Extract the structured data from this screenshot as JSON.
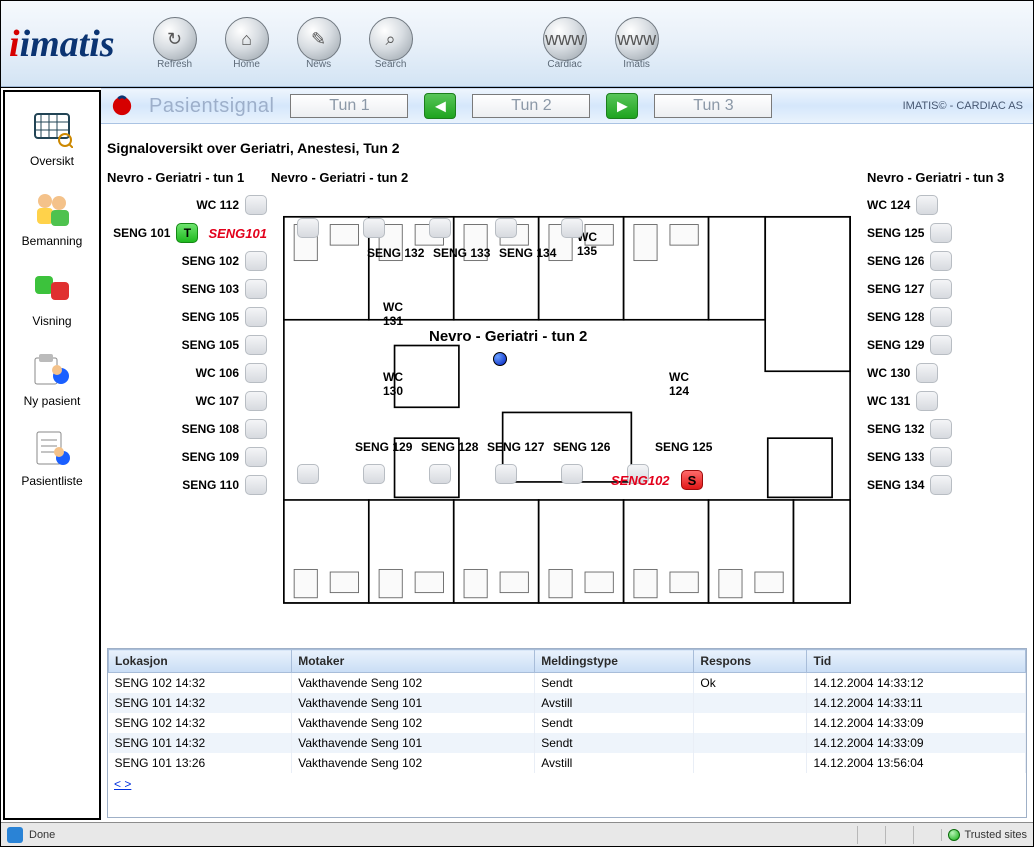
{
  "logo_text": "imatis",
  "top_buttons": [
    {
      "label": "Refresh",
      "icon": "↻"
    },
    {
      "label": "Home",
      "icon": "⌂"
    },
    {
      "label": "News",
      "icon": "✎"
    },
    {
      "label": "Search",
      "icon": "⌕"
    },
    {
      "label": "Cardiac",
      "icon": "www"
    },
    {
      "label": "Imatis",
      "icon": "www"
    }
  ],
  "sidebar": [
    {
      "label": "Oversikt",
      "name": "side-oversikt"
    },
    {
      "label": "Bemanning",
      "name": "side-bemanning"
    },
    {
      "label": "Visning",
      "name": "side-visning"
    },
    {
      "label": "Ny pasient",
      "name": "side-ny-pasient"
    },
    {
      "label": "Pasientliste",
      "name": "side-pasientliste"
    }
  ],
  "psbar": {
    "title": "Pasientsignal",
    "tuns": [
      "Tun 1",
      "Tun 2",
      "Tun 3"
    ],
    "right": "IMATIS© - CARDIAC AS"
  },
  "heading": "Signaloversikt over Geriatri, Anestesi, Tun 2",
  "columns": {
    "left": {
      "title": "Nevro - Geriatri - tun 1",
      "rooms": [
        {
          "label": "WC 112",
          "chip": "grey"
        },
        {
          "label": "SENG 101",
          "chip": "green",
          "chiptext": "T",
          "highlight": "SENG101"
        },
        {
          "label": "SENG 102",
          "chip": "grey"
        },
        {
          "label": "SENG 103",
          "chip": "grey"
        },
        {
          "label": "SENG 105",
          "chip": "grey"
        },
        {
          "label": "SENG 105",
          "chip": "grey"
        },
        {
          "label": "WC 106",
          "chip": "grey"
        },
        {
          "label": "WC 107",
          "chip": "grey"
        },
        {
          "label": "SENG 108",
          "chip": "grey"
        },
        {
          "label": "SENG 109",
          "chip": "grey"
        },
        {
          "label": "SENG 110",
          "chip": "grey"
        }
      ]
    },
    "middle": {
      "title": "Nevro - Geriatri - tun 2"
    },
    "right": {
      "title": "Nevro - Geriatri - tun 3",
      "rooms": [
        {
          "label": "WC 124",
          "chip": "grey"
        },
        {
          "label": "SENG 125",
          "chip": "grey"
        },
        {
          "label": "SENG 126",
          "chip": "grey"
        },
        {
          "label": "SENG 127",
          "chip": "grey"
        },
        {
          "label": "SENG 128",
          "chip": "grey"
        },
        {
          "label": "SENG 129",
          "chip": "grey"
        },
        {
          "label": "WC 130",
          "chip": "grey"
        },
        {
          "label": "WC 131",
          "chip": "grey"
        },
        {
          "label": "SENG 132",
          "chip": "grey"
        },
        {
          "label": "SENG 133",
          "chip": "grey"
        },
        {
          "label": "SENG 134",
          "chip": "grey"
        }
      ]
    }
  },
  "floorplan": {
    "title": "Nevro - Geriatri - tun 2",
    "rooms_top": [
      "SENG 132",
      "SENG 133",
      "SENG 134"
    ],
    "wc_top_right": "WC 135",
    "wc_left_top": "WC 131",
    "wc_left_bot": "WC 130",
    "wc_right_bot": "WC 124",
    "rooms_bottom": [
      "SENG 129",
      "SENG 128",
      "SENG 127",
      "SENG 126",
      "SENG 125"
    ],
    "alert_left": {
      "text": "SENG101",
      "chip": "T"
    },
    "alert_right": {
      "text": "SENG102",
      "chip": "S"
    }
  },
  "table": {
    "headers": [
      "Lokasjon",
      "Motaker",
      "Meldingstype",
      "Respons",
      "Tid"
    ],
    "rows": [
      [
        "SENG 102 14:32",
        "Vakthavende Seng 102",
        "Sendt",
        "Ok",
        "14.12.2004 14:33:12"
      ],
      [
        "SENG 101 14:32",
        "Vakthavende Seng 101",
        "Avstill",
        "",
        "14.12.2004 14:33:11"
      ],
      [
        "SENG 102 14:32",
        "Vakthavende Seng 102",
        "Sendt",
        "",
        "14.12.2004 14:33:09"
      ],
      [
        "SENG 101 14:32",
        "Vakthavende Seng 101",
        "Sendt",
        "",
        "14.12.2004 14:33:09"
      ],
      [
        "SENG 101 13:26",
        "Vakthavende Seng 102",
        "Avstill",
        "",
        "14.12.2004 13:56:04"
      ]
    ],
    "more": "< >"
  },
  "statusbar": {
    "done": "Done",
    "zone": "Trusted sites"
  }
}
